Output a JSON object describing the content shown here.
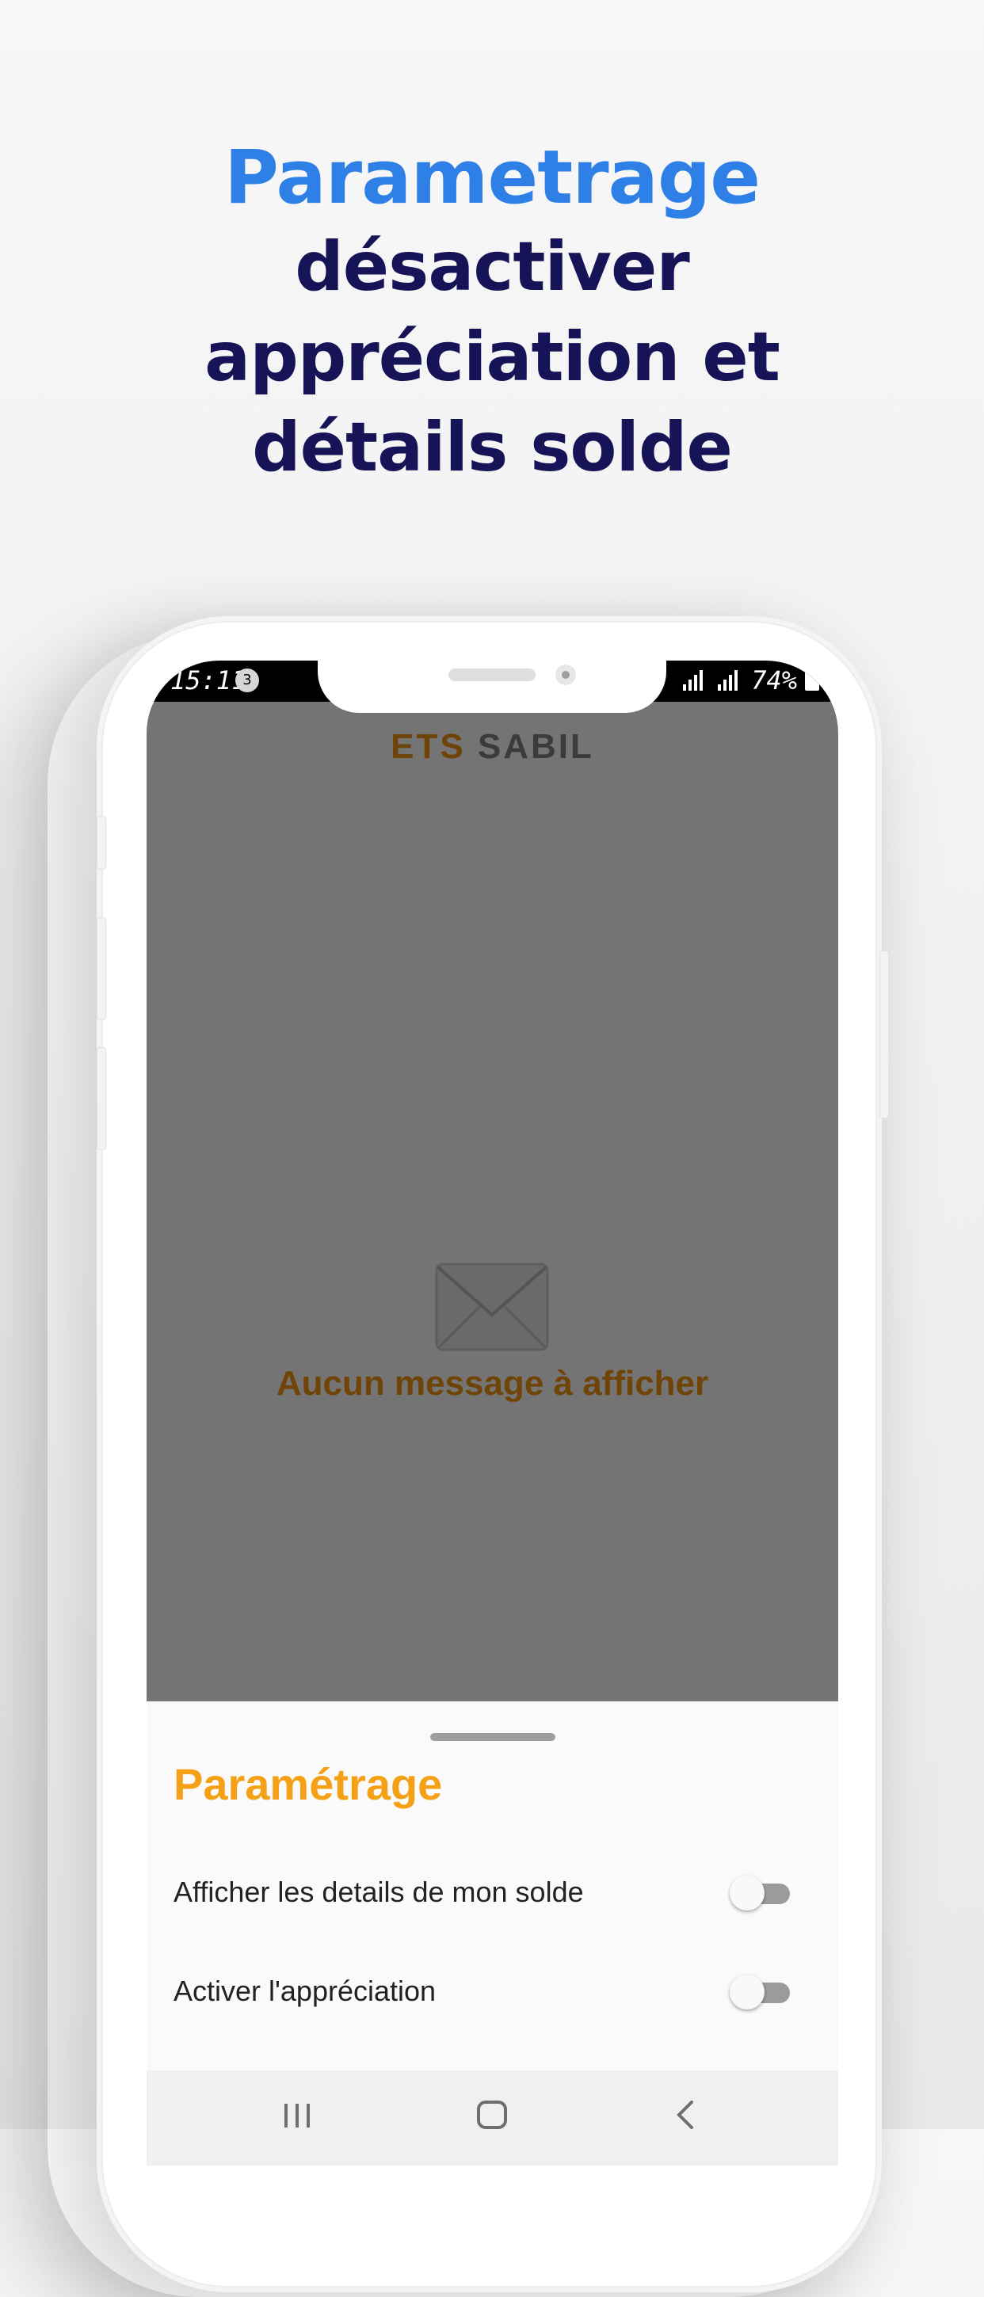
{
  "headline": {
    "accent": "Parametrage",
    "line1": "désactiver",
    "line2": "appréciation et",
    "line3": "détails solde"
  },
  "status_bar": {
    "time": "15:11",
    "notification_count": "3",
    "battery": "74%",
    "icons": [
      "notification-badge-icon",
      "signal-icon",
      "battery-icon"
    ]
  },
  "app": {
    "title_part1": "ETS",
    "title_part2": "SABIL",
    "empty_state": {
      "icon": "envelope-icon",
      "message": "Aucun message à afficher"
    }
  },
  "settings_sheet": {
    "title": "Paramétrage",
    "options": [
      {
        "label": "Afficher les details de mon solde",
        "enabled": false
      },
      {
        "label": "Activer l'appréciation",
        "enabled": false
      }
    ]
  },
  "navigation": {
    "buttons": [
      "recent-apps-icon",
      "home-icon",
      "back-icon"
    ]
  },
  "colors": {
    "headline_accent": "#2f80e6",
    "headline_main": "#171357",
    "sheet_title": "#f5a117",
    "empty_text": "#6f4406"
  }
}
